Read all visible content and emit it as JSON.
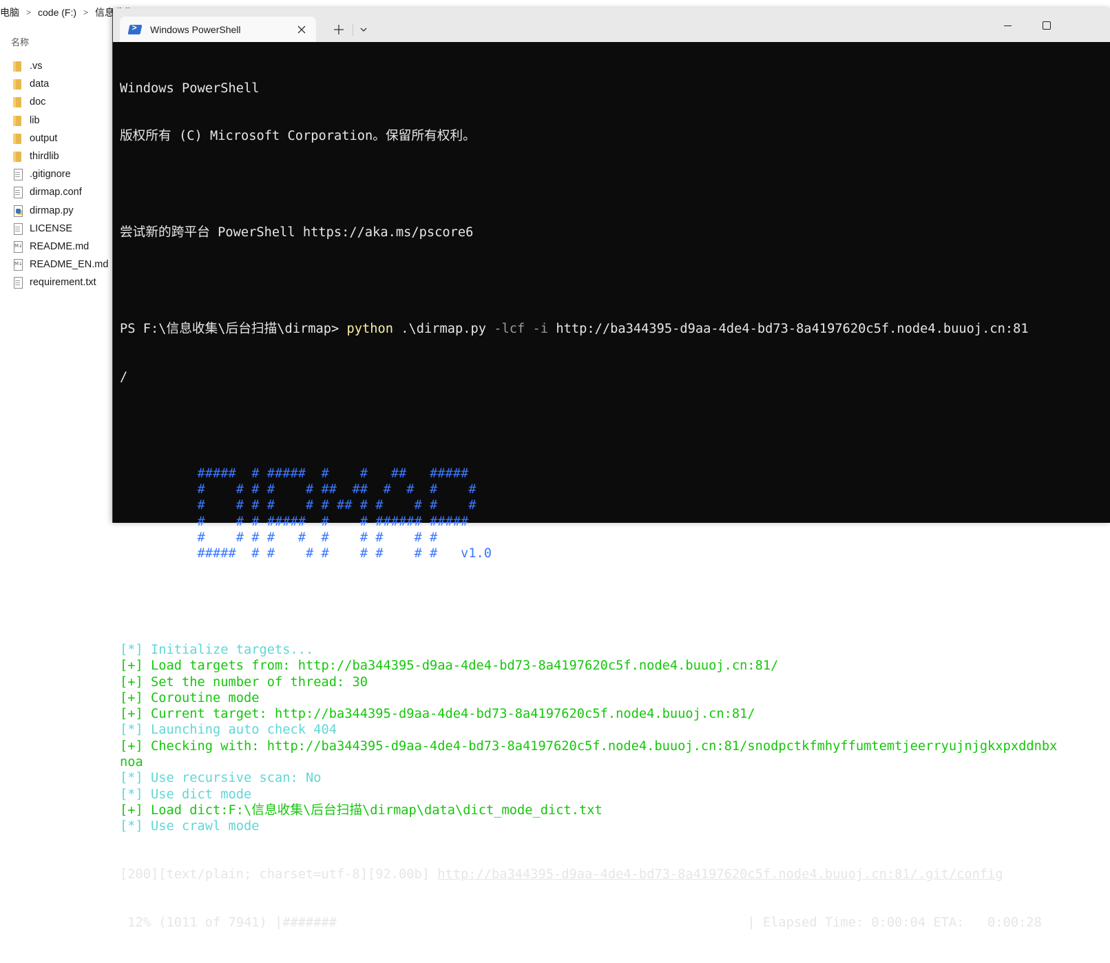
{
  "explorer": {
    "breadcrumb": [
      "电脑",
      "code (F:)",
      "信息收集"
    ],
    "column_header": "名称",
    "files": [
      {
        "name": ".vs",
        "type": "folder"
      },
      {
        "name": "data",
        "type": "folder"
      },
      {
        "name": "doc",
        "type": "folder"
      },
      {
        "name": "lib",
        "type": "folder"
      },
      {
        "name": "output",
        "type": "folder"
      },
      {
        "name": "thirdlib",
        "type": "folder"
      },
      {
        "name": ".gitignore",
        "type": "file"
      },
      {
        "name": "dirmap.conf",
        "type": "file"
      },
      {
        "name": "dirmap.py",
        "type": "py"
      },
      {
        "name": "LICENSE",
        "type": "file"
      },
      {
        "name": "README.md",
        "type": "md"
      },
      {
        "name": "README_EN.md",
        "type": "md"
      },
      {
        "name": "requirement.txt",
        "type": "file"
      }
    ]
  },
  "terminal": {
    "tab_title": "Windows PowerShell",
    "header_line1": "Windows PowerShell",
    "header_line2": "版权所有 (C) Microsoft Corporation。保留所有权利。",
    "header_line3": "尝试新的跨平台 PowerShell https://aka.ms/pscore6",
    "prompt": "PS F:\\信息收集\\后台扫描\\dirmap> ",
    "cmd_exe": "python",
    "cmd_script": " .\\dirmap.py ",
    "cmd_flags": "-lcf -i",
    "cmd_url": " http://ba344395-d9aa-4de4-bd73-8a4197620c5f.node4.buuoj.cn:81",
    "cmd_wrap": "/",
    "banner": [
      "          #####  # #####  #    #   ##   #####",
      "          #    # # #    # ##  ##  #  #  #    #",
      "          #    # # #    # # ## # #    # #    #",
      "          #    # # #####  #    # ###### #####",
      "          #    # # #   #  #    # #    # #",
      "          #####  # #    # #    # #    # #   "
    ],
    "version": "v1.0",
    "log": [
      {
        "tag": "[*] ",
        "text": "Initialize targets...",
        "color": "cyan"
      },
      {
        "tag": "[+] ",
        "text": "Load targets from: http://ba344395-d9aa-4de4-bd73-8a4197620c5f.node4.buuoj.cn:81/",
        "color": "green"
      },
      {
        "tag": "[+] ",
        "text": "Set the number of thread: 30",
        "color": "green"
      },
      {
        "tag": "[+] ",
        "text": "Coroutine mode",
        "color": "green"
      },
      {
        "tag": "[+] ",
        "text": "Current target: http://ba344395-d9aa-4de4-bd73-8a4197620c5f.node4.buuoj.cn:81/",
        "color": "green"
      },
      {
        "tag": "[*] ",
        "text": "Launching auto check 404",
        "color": "cyan"
      },
      {
        "tag": "[+] ",
        "text": "Checking with: http://ba344395-d9aa-4de4-bd73-8a4197620c5f.node4.buuoj.cn:81/snodpctkfmhyffumtemtjeerryujnjgkxpxddnbx",
        "color": "green"
      },
      {
        "tag": "",
        "text": "noa",
        "color": "green"
      },
      {
        "tag": "[*] ",
        "text": "Use recursive scan: No",
        "color": "cyan"
      },
      {
        "tag": "[*] ",
        "text": "Use dict mode",
        "color": "cyan"
      },
      {
        "tag": "[+] ",
        "text": "Load dict:F:\\信息收集\\后台扫描\\dirmap\\data\\dict_mode_dict.txt",
        "color": "green"
      },
      {
        "tag": "[*] ",
        "text": "Use crawl mode",
        "color": "cyan"
      }
    ],
    "result_prefix": "[200][text/plain; charset=utf-8][92.00b] ",
    "result_url": "http://ba344395-d9aa-4de4-bd73-8a4197620c5f.node4.buuoj.cn:81/.git/config",
    "progress_line": " 12% (1011 of 7941) |#######                                                     | Elapsed Time: 0:00:04 ETA:   0:00:28"
  },
  "colors": {
    "terminal_bg": "#0c0c0c",
    "prompt_text": "#cccccc",
    "command_exe": "#f9f1a5",
    "banner": "#3b78ff",
    "info_tag": "#61d6d6",
    "success_tag": "#16c60c"
  }
}
